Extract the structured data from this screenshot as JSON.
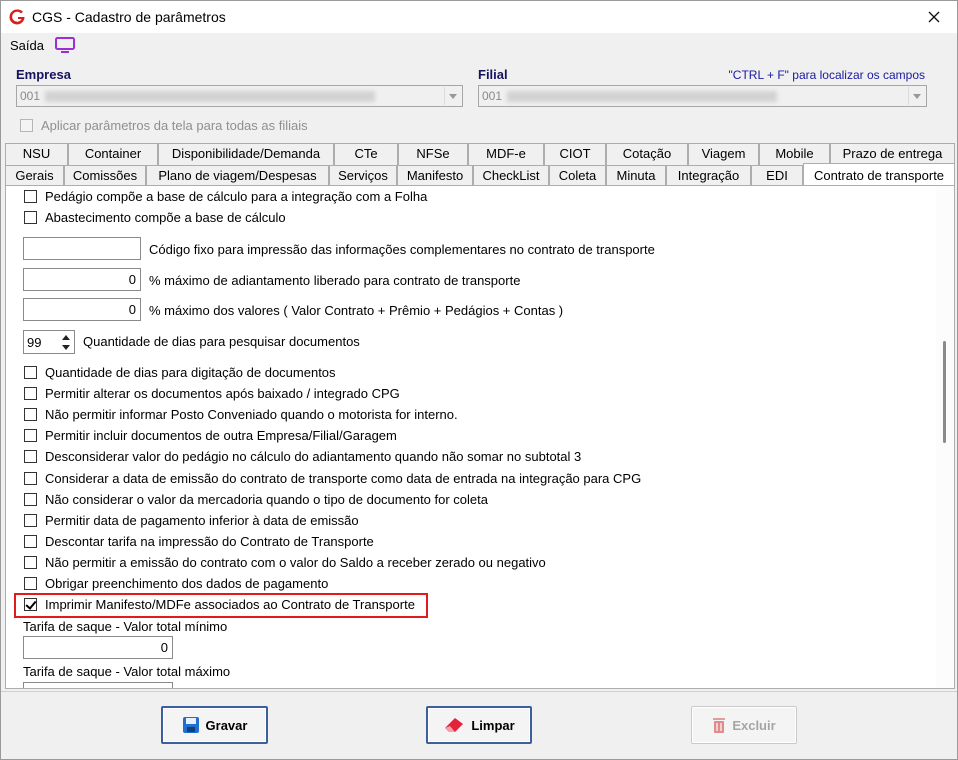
{
  "window": {
    "title": "CGS - Cadastro de parâmetros"
  },
  "toolbar": {
    "saida_label": "Saída"
  },
  "empresa": {
    "label": "Empresa",
    "value": "001"
  },
  "filial": {
    "label": "Filial",
    "value": "001"
  },
  "hint": "\"CTRL + F\" para localizar os campos",
  "apply_all": {
    "label": "Aplicar parâmetros da tela para todas as filiais",
    "checked": false
  },
  "tabs_row1": [
    "NSU",
    "Container",
    "Disponibilidade/Demanda",
    "CTe",
    "NFSe",
    "MDF-e",
    "CIOT",
    "Cotação",
    "Viagem",
    "Mobile",
    "Prazo de entrega"
  ],
  "tabs_row2": [
    "Gerais",
    "Comissões",
    "Plano de viagem/Despesas",
    "Serviços",
    "Manifesto",
    "CheckList",
    "Coleta",
    "Minuta",
    "Integração",
    "EDI",
    "Contrato de transporte"
  ],
  "active_tab": "Contrato de transporte",
  "panel": {
    "top_checks": [
      {
        "label": "Pedágio compõe a base de cálculo para a integração com a Folha",
        "checked": false
      },
      {
        "label": "Abastecimento compõe a base de cálculo",
        "checked": false
      }
    ],
    "fields": [
      {
        "value": "",
        "label": "Código fixo para impressão das informações complementares no contrato de transporte"
      },
      {
        "value": "0",
        "label": "% máximo de adiantamento liberado para contrato de transporte"
      },
      {
        "value": "0",
        "label": "% máximo dos valores ( Valor Contrato + Prêmio + Pedágios + Contas )"
      }
    ],
    "spin": {
      "value": "99",
      "label": "Quantidade de dias para pesquisar documentos"
    },
    "checks": [
      {
        "label": "Quantidade de dias para digitação de documentos",
        "checked": false
      },
      {
        "label": "Permitir alterar os documentos após baixado / integrado CPG",
        "checked": false
      },
      {
        "label": "Não permitir informar Posto Conveniado quando o motorista for interno.",
        "checked": false
      },
      {
        "label": "Permitir incluir documentos de outra Empresa/Filial/Garagem",
        "checked": false
      },
      {
        "label": "Desconsiderar valor do pedágio no cálculo do adiantamento quando não somar no subtotal 3",
        "checked": false
      },
      {
        "label": "Considerar a data de emissão do contrato de transporte como data de entrada na integração para CPG",
        "checked": false
      },
      {
        "label": "Não considerar o valor da mercadoria quando o tipo de documento for coleta",
        "checked": false
      },
      {
        "label": "Permitir data de pagamento inferior à data de emissão",
        "checked": false
      },
      {
        "label": "Descontar tarifa na impressão do Contrato de Transporte",
        "checked": false
      },
      {
        "label": "Não permitir a emissão do contrato com o valor do Saldo a receber zerado ou negativo",
        "checked": false
      },
      {
        "label": "Obrigar preenchimento dos dados de pagamento",
        "checked": false
      },
      {
        "label": "Imprimir Manifesto/MDFe associados ao Contrato de Transporte",
        "checked": true
      }
    ],
    "tarifa_min": {
      "label": "Tarifa de saque - Valor total mínimo",
      "value": "0"
    },
    "tarifa_max": {
      "label": "Tarifa de saque - Valor total máximo",
      "value": ""
    }
  },
  "buttons": {
    "gravar": "Gravar",
    "limpar": "Limpar",
    "excluir": "Excluir"
  },
  "colors": {
    "highlight": "#e11b1b",
    "label_blue": "#16135e",
    "hint_blue": "#1a1aa0"
  }
}
